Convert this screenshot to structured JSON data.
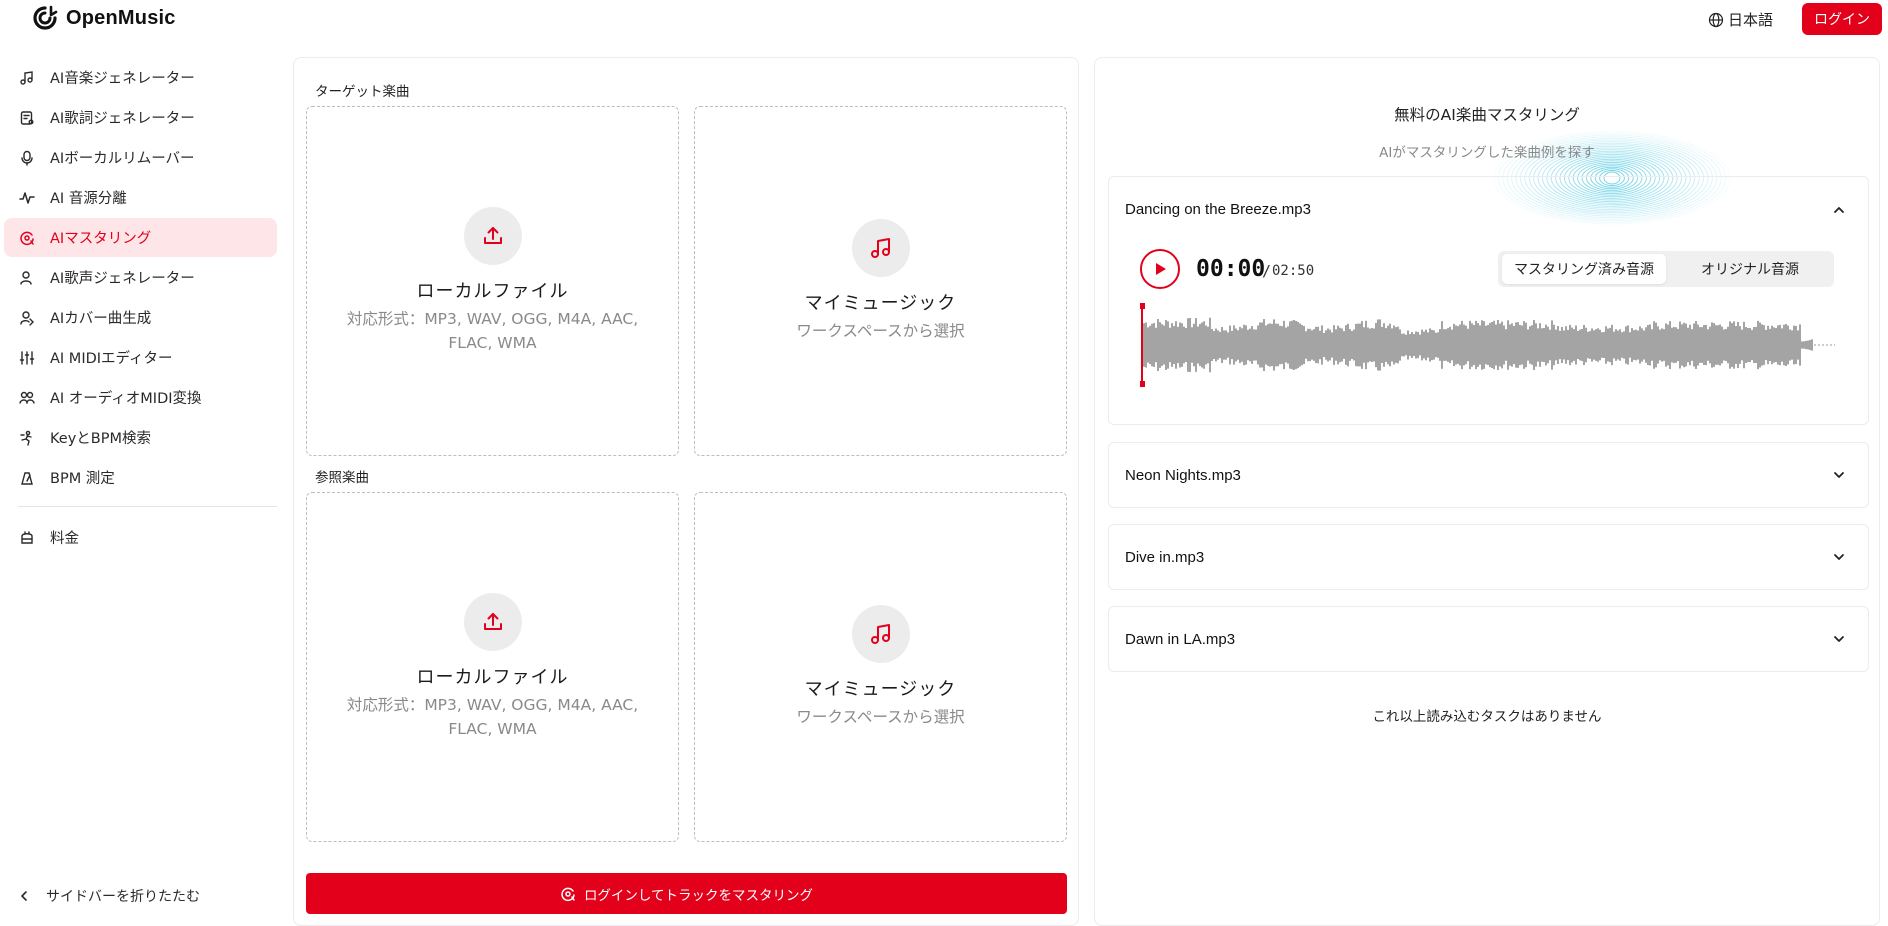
{
  "header": {
    "brand": "OpenMusic",
    "language": "日本語",
    "login": "ログイン"
  },
  "sidebar": {
    "items": [
      {
        "label": "AI音楽ジェネレーター",
        "icon": "music-note-icon"
      },
      {
        "label": "AI歌詞ジェネレーター",
        "icon": "lyrics-icon"
      },
      {
        "label": "AIボーカルリムーバー",
        "icon": "vocal-remover-icon"
      },
      {
        "label": "AI 音源分離",
        "icon": "stem-split-icon"
      },
      {
        "label": "AIマスタリング",
        "icon": "mastering-icon",
        "active": true
      },
      {
        "label": "AI歌声ジェネレーター",
        "icon": "singer-icon"
      },
      {
        "label": "AIカバー曲生成",
        "icon": "cover-icon"
      },
      {
        "label": "AI MIDIエディター",
        "icon": "midi-editor-icon"
      },
      {
        "label": "AI オーディオMIDI変換",
        "icon": "audio-midi-icon"
      },
      {
        "label": "KeyとBPM検索",
        "icon": "key-bpm-icon"
      },
      {
        "label": "BPM 測定",
        "icon": "bpm-icon"
      }
    ],
    "pricing": "料金",
    "collapse": "サイドバーを折りたたむ"
  },
  "main": {
    "target_label": "ターゲット楽曲",
    "reference_label": "参照楽曲",
    "local_file": {
      "title": "ローカルファイル",
      "formats": "対応形式：MP3, WAV, OGG, M4A, AAC, FLAC, WMA"
    },
    "my_music": {
      "title": "マイミュージック",
      "subtitle": "ワークスペースから選択"
    },
    "cta": "ログインしてトラックをマスタリング"
  },
  "examples": {
    "title": "無料のAI楽曲マスタリング",
    "subtitle": "AIがマスタリングした楽曲例を探す",
    "tracks": [
      {
        "name": "Dancing on the Breeze.mp3",
        "expanded": true
      },
      {
        "name": "Neon Nights.mp3",
        "expanded": false
      },
      {
        "name": "Dive in.mp3",
        "expanded": false
      },
      {
        "name": "Dawn in LA.mp3",
        "expanded": false
      }
    ],
    "player": {
      "current": "00:00",
      "separator": "/",
      "total": "02:50",
      "tab_mastered": "マスタリング済み音源",
      "tab_original": "オリジナル音源",
      "progress": 0
    },
    "no_more": "これ以上読み込むタスクはありません"
  },
  "colors": {
    "accent": "#e3001b",
    "active_bg": "#fde5e8",
    "wave": "#4a4a4a"
  }
}
